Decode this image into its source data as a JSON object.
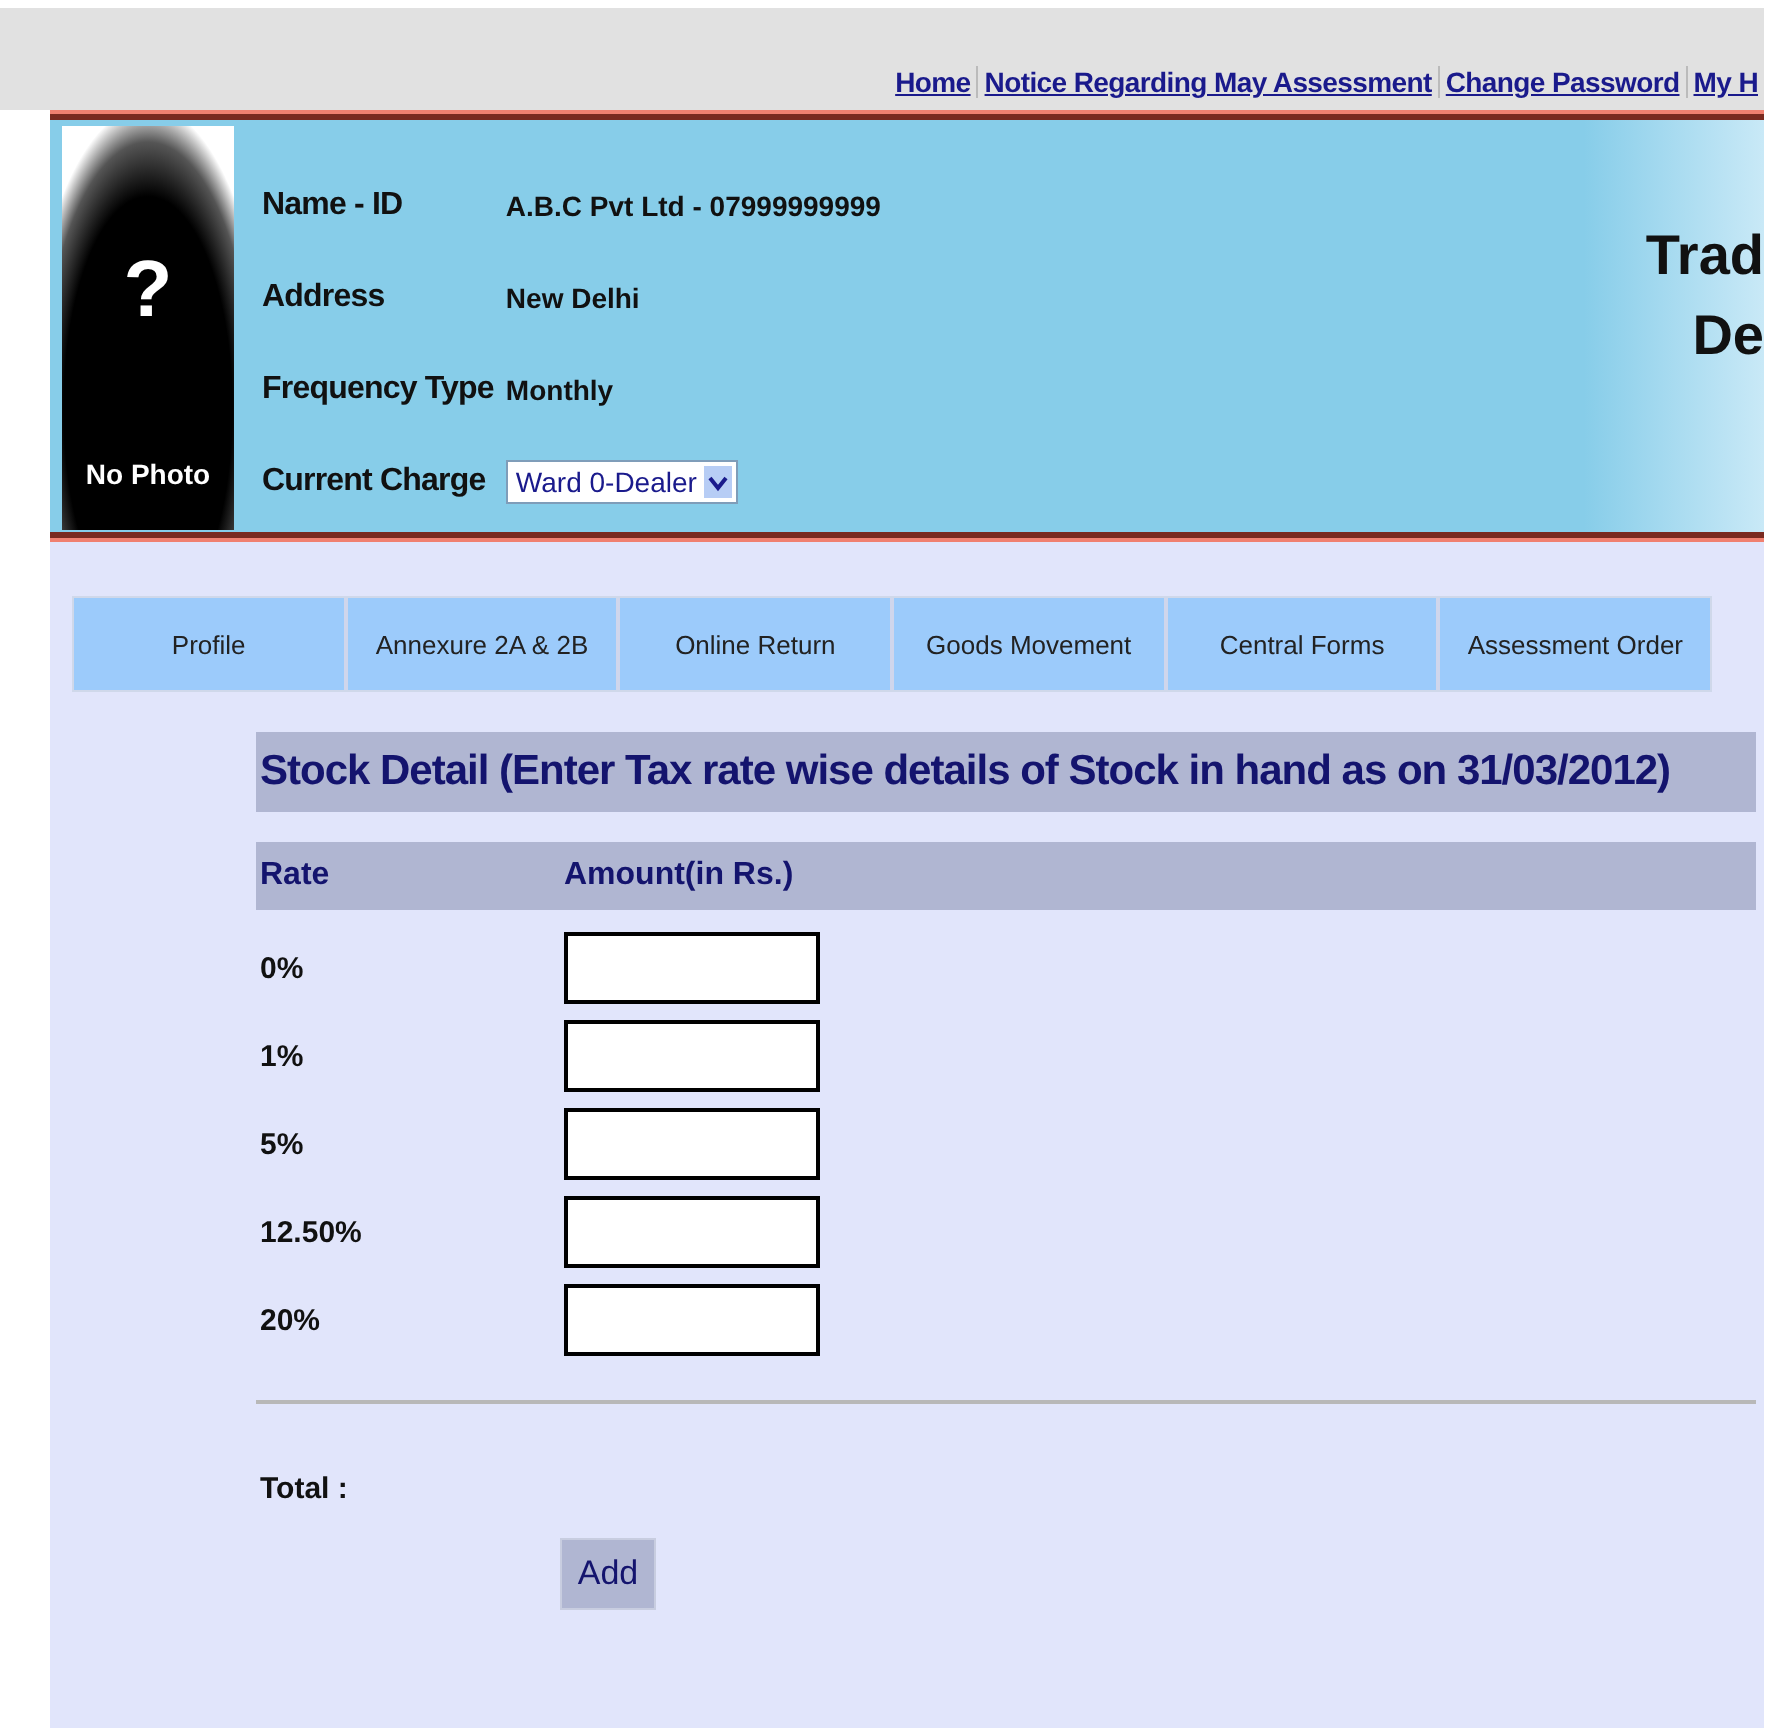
{
  "top_links": [
    "Home",
    "Notice Regarding May Assessment",
    "Change Password",
    "My H"
  ],
  "profile": {
    "photo_mark": "?",
    "photo_caption": "No Photo",
    "fields": [
      {
        "label": "Name - ID",
        "value": "A.B.C Pvt Ltd - 07999999999",
        "kind": "text"
      },
      {
        "label": "Address",
        "value": "New Delhi",
        "kind": "text"
      },
      {
        "label": "Frequency Type",
        "value": "Monthly",
        "kind": "text"
      },
      {
        "label": "Current Charge",
        "value": "Ward 0-Dealer",
        "kind": "select"
      }
    ],
    "side_title": [
      "Trad",
      "De"
    ]
  },
  "tabs": [
    {
      "label": "Profile",
      "selected": false
    },
    {
      "label": "Annexure 2A & 2B",
      "selected": false
    },
    {
      "label": "Online Return",
      "selected": false
    },
    {
      "label": "Goods Movement",
      "selected": false
    },
    {
      "label": "Central Forms",
      "selected": false
    },
    {
      "label": "Assessment Order",
      "selected": false
    }
  ],
  "stock": {
    "title": "Stock Detail (Enter Tax rate wise details of Stock in hand as on 31/03/2012)",
    "columns": [
      "Rate",
      "Amount(in Rs.)"
    ],
    "rows": [
      {
        "rate": "0%"
      },
      {
        "rate": "1%"
      },
      {
        "rate": "5%"
      },
      {
        "rate": "12.50%"
      },
      {
        "rate": "20%"
      }
    ],
    "total_label": "Total :",
    "add_button": "Add"
  }
}
